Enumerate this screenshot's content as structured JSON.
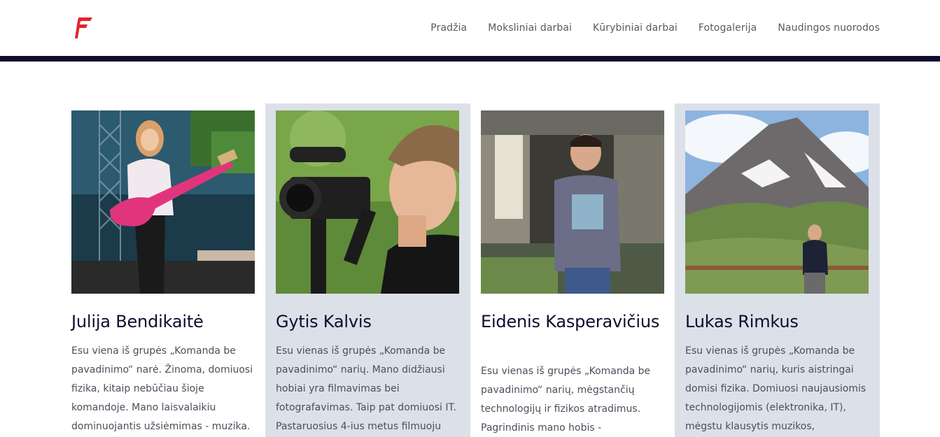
{
  "brand": {
    "logo_icon": "red-f-logo-icon",
    "accent": "#e3232f",
    "header_bar_color": "#0f0c2e"
  },
  "nav": {
    "items": [
      {
        "label": "Pradžia"
      },
      {
        "label": "Moksliniai darbai"
      },
      {
        "label": "Kūrybiniai darbai"
      },
      {
        "label": "Fotogalerija"
      },
      {
        "label": "Naudingos nuorodos"
      }
    ]
  },
  "team": [
    {
      "name": "Julija Bendikaitė",
      "photo": "bass-guitarist-stage-photo",
      "text": "Esu viena iš grupės „Komanda be pavadinimo“ narė. Žinoma, domiuosi fizika, kitaip nebūčiau šioje komandoje. Mano laisvalaikiu dominuojantis užsiėmimas - muzika."
    },
    {
      "name": "Gytis Kalvis",
      "photo": "camera-operator-photo",
      "text": "Esu vienas iš grupės „Komanda be pavadinimo“ narių. Mano didžiausi hobiai yra filmavimas bei fotografavimas. Taip pat domiuosi IT. Pastaruosius 4-ius metus filmuoju"
    },
    {
      "name": "Eidenis Kasperavičius",
      "photo": "boy-under-bridge-photo",
      "text": "Esu vienas iš grupės „Komanda be pavadinimo“ narių, mėgstančių technologijų ir fizikos atradimus. Pagrindinis mano hobis -"
    },
    {
      "name": "Lukas Rimkus",
      "photo": "mountain-matterhorn-photo",
      "text": "Esu vienas iš grupės „Komanda be pavadinimo“ narių, kuris aistringai domisi fizika. Domiuosi naujausiomis technologijomis (elektronika, IT), mėgstu klausytis muzikos, laisvalaikiu"
    }
  ]
}
